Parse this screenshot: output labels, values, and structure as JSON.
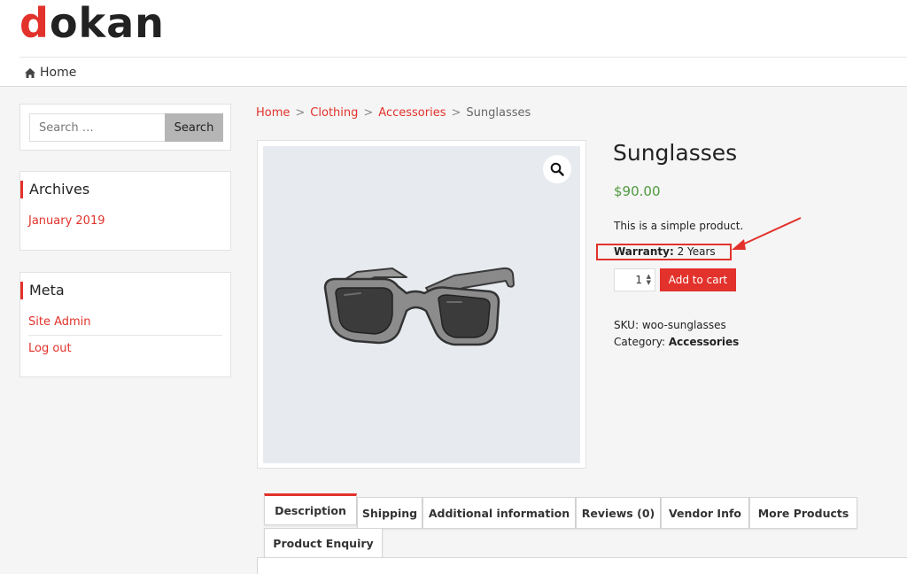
{
  "brand": {
    "logo_first": "d",
    "logo_rest": "okan",
    "accent_color": "#e2322b"
  },
  "nav": {
    "home_label": "Home"
  },
  "sidebar": {
    "search": {
      "placeholder": "Search …",
      "button_label": "Search"
    },
    "archives": {
      "title": "Archives",
      "items": [
        {
          "label": "January 2019"
        }
      ]
    },
    "meta": {
      "title": "Meta",
      "items": [
        {
          "label": "Site Admin"
        },
        {
          "label": "Log out"
        }
      ]
    }
  },
  "breadcrumb": {
    "items": [
      {
        "label": "Home"
      },
      {
        "label": "Clothing"
      },
      {
        "label": "Accessories"
      }
    ],
    "separator": ">",
    "current": "Sunglasses"
  },
  "product": {
    "title": "Sunglasses",
    "price": "$90.00",
    "price_color": "#4e9a3d",
    "short_description": "This is a simple product.",
    "warranty_label": "Warranty:",
    "warranty_value": "2 Years",
    "quantity": "1",
    "add_to_cart_label": "Add to cart",
    "sku_label": "SKU:",
    "sku_value": "woo-sunglasses",
    "category_label": "Category:",
    "category_value": "Accessories",
    "image_icon": "sunglasses-image",
    "zoom_icon": "magnifier-icon"
  },
  "tabs": [
    {
      "label": "Description",
      "active": true
    },
    {
      "label": "Shipping"
    },
    {
      "label": "Additional information"
    },
    {
      "label": "Reviews (0)"
    },
    {
      "label": "Vendor Info"
    },
    {
      "label": "More Products"
    },
    {
      "label": "Product Enquiry"
    }
  ]
}
